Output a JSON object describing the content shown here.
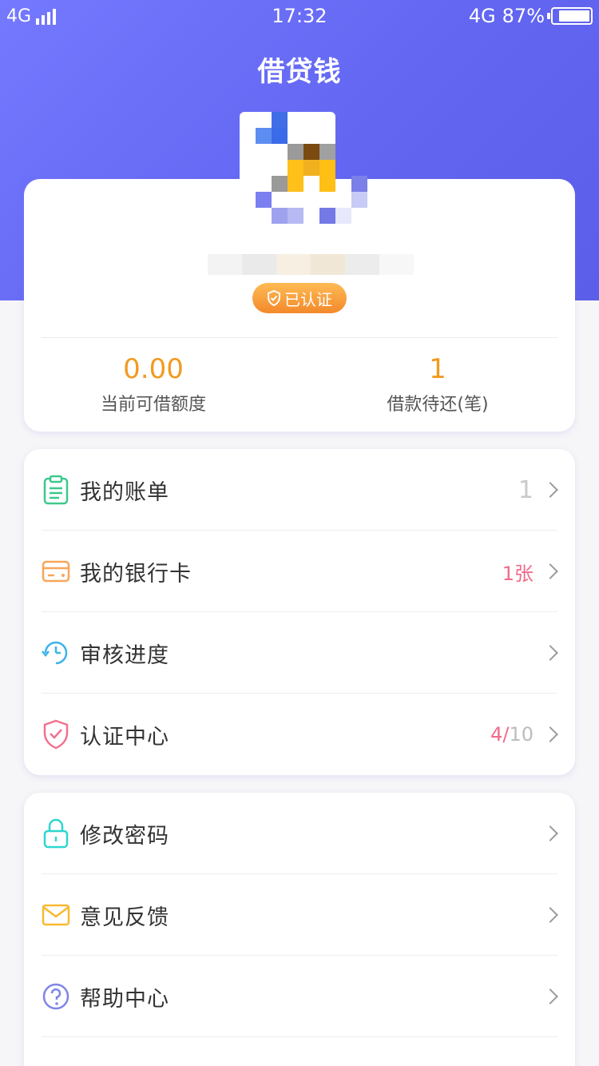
{
  "status_bar": {
    "network": "4G",
    "time": "17:32",
    "network_right": "4G",
    "battery": "87%",
    "battery_level": 0.87
  },
  "header": {
    "title": "借贷钱"
  },
  "profile": {
    "verified_label": "已认证",
    "stats": [
      {
        "value": "0.00",
        "label": "当前可借额度"
      },
      {
        "value": "1",
        "label": "借款待还(笔)"
      }
    ]
  },
  "menu_group_1": [
    {
      "label": "我的账单",
      "value": "1",
      "icon": "clipboard-icon"
    },
    {
      "label": "我的银行卡",
      "value": "1张",
      "icon": "bank-card-icon"
    },
    {
      "label": "审核进度",
      "value": "",
      "icon": "clock-icon"
    },
    {
      "label": "认证中心",
      "value_done": "4/",
      "value_total": "10",
      "icon": "shield-icon"
    }
  ],
  "menu_group_2": [
    {
      "label": "修改密码",
      "icon": "lock-icon"
    },
    {
      "label": "意见反馈",
      "icon": "mail-icon"
    },
    {
      "label": "帮助中心",
      "icon": "question-icon"
    }
  ],
  "colors": {
    "header_gradient_start": "#7479ff",
    "header_gradient_end": "#5a5ee8",
    "stat_number": "#f19a21",
    "badge_value": "#f06b8a",
    "muted_value": "#bdbdbd",
    "green_icon": "#3cc98b",
    "orange_icon": "#f7a65a",
    "blue_icon": "#3db4e8",
    "pink_icon": "#f2728f",
    "teal_icon": "#2fd6d0",
    "yellow_icon": "#f8b932",
    "purple_icon": "#7f85e6"
  }
}
